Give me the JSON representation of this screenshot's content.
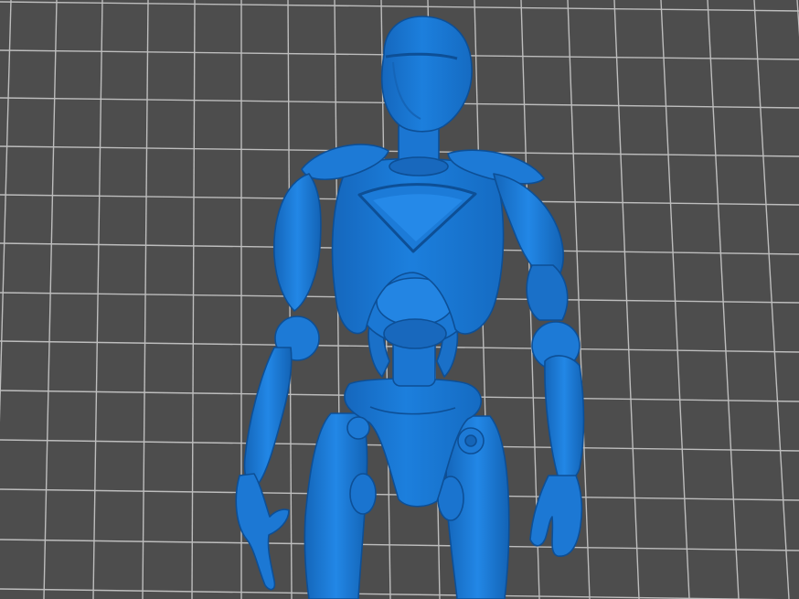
{
  "viewer": {
    "background_color": "#4d4d4d",
    "grid_color": "#c8c8c8",
    "model_color": "#1a78d6",
    "model_shadow_color": "#0f5cab",
    "model_highlight_color": "#3d95ea"
  },
  "model": {
    "icon": "humanoid-robot-figure"
  }
}
